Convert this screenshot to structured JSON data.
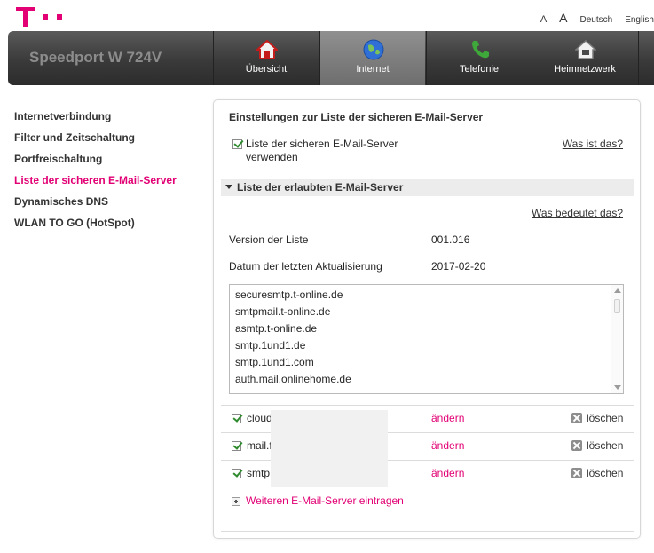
{
  "brand": {
    "accent": "#e20074"
  },
  "topnav": {
    "font_small": "A",
    "font_large": "A",
    "lang_de": "Deutsch",
    "lang_en": "English"
  },
  "header": {
    "product": "Speedport W 724V",
    "tabs": [
      {
        "label": "Übersicht",
        "icon": "home-icon"
      },
      {
        "label": "Internet",
        "icon": "globe-icon",
        "active": true
      },
      {
        "label": "Telefonie",
        "icon": "phone-icon"
      },
      {
        "label": "Heimnetzwerk",
        "icon": "home-network-icon"
      }
    ]
  },
  "sidebar": {
    "items": [
      {
        "label": "Internetverbindung"
      },
      {
        "label": "Filter und Zeitschaltung"
      },
      {
        "label": "Portfreischaltung"
      },
      {
        "label": "Liste der sicheren E-Mail-Server",
        "active": true
      },
      {
        "label": "Dynamisches DNS"
      },
      {
        "label": "WLAN TO GO (HotSpot)"
      }
    ]
  },
  "panel": {
    "title": "Einstellungen zur Liste der sicheren E-Mail-Server",
    "use_list_label": "Liste der sicheren E-Mail-Server verwenden",
    "use_list_checked": true,
    "what_is_link": "Was ist das?",
    "section_title": "Liste der erlaubten E-Mail-Server",
    "what_means_link": "Was bedeutet das?",
    "version_label": "Version der Liste",
    "version_value": "001.016",
    "date_label": "Datum der letzten Aktualisierung",
    "date_value": "2017-02-20",
    "server_list": [
      "securesmtp.t-online.de",
      "smtpmail.t-online.de",
      "asmtp.t-online.de",
      "smtp.1und1.de",
      "smtp.1und1.com",
      "auth.mail.onlinehome.de"
    ],
    "custom_servers": [
      {
        "name": "cloud",
        "checked": true,
        "change": "ändern",
        "delete": "löschen"
      },
      {
        "name": "mail.f",
        "checked": true,
        "change": "ändern",
        "delete": "löschen"
      },
      {
        "name": "smtp.",
        "checked": true,
        "change": "ändern",
        "delete": "löschen"
      }
    ],
    "add_label": "Weiteren E-Mail-Server eintragen"
  }
}
